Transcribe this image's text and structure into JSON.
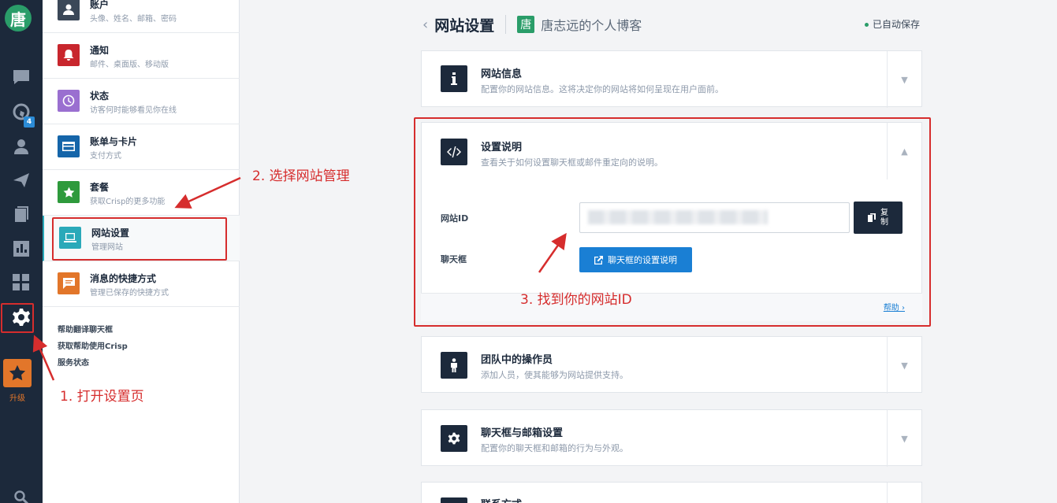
{
  "rail": {
    "logo_char": "唐",
    "badge": "4",
    "upgrade_label": "升级",
    "items": [
      "chat-icon",
      "globe-icon",
      "contacts-icon",
      "send-icon",
      "book-icon",
      "analytics-icon",
      "plugins-icon",
      "gear-icon",
      "star-icon",
      "search-icon"
    ]
  },
  "menu": {
    "items": [
      {
        "title": "账户",
        "sub": "头像、姓名、邮箱、密码",
        "color": "#3b4858",
        "icon": "user-icon"
      },
      {
        "title": "通知",
        "sub": "邮件、桌面版、移动版",
        "color": "#c8262d",
        "icon": "bell-icon"
      },
      {
        "title": "状态",
        "sub": "访客何时能够看见你在线",
        "color": "#9a6fd0",
        "icon": "clock-icon"
      },
      {
        "title": "账单与卡片",
        "sub": "支付方式",
        "color": "#1565a9",
        "icon": "card-icon"
      },
      {
        "title": "套餐",
        "sub": "获取Crisp的更多功能",
        "color": "#2e9a3c",
        "icon": "star-icon"
      },
      {
        "title": "网站设置",
        "sub": "管理网站",
        "color": "#2aa9b9",
        "icon": "laptop-icon"
      },
      {
        "title": "消息的快捷方式",
        "sub": "管理已保存的快捷方式",
        "color": "#e2762a",
        "icon": "message-icon"
      }
    ],
    "links": [
      "帮助翻译聊天框",
      "获取帮助使用Crisp",
      "服务状态"
    ]
  },
  "header": {
    "back": "‹",
    "title": "网站设置",
    "site_icon_char": "唐",
    "site_name": "唐志远的个人博客",
    "autosave": "已自动保存"
  },
  "cards": {
    "info": {
      "title": "网站信息",
      "sub": "配置你的网站信息。这将决定你的网站将如何呈现在用户面前。",
      "chevron": "▼"
    },
    "setup": {
      "title": "设置说明",
      "sub": "查看关于如何设置聊天框或邮件重定向的说明。",
      "chevron": "▲",
      "id_label": "网站ID",
      "chat_label": "聊天框",
      "copy_label": "复制",
      "chat_button": "聊天框的设置说明",
      "help": "帮助 ›"
    },
    "operators": {
      "title": "团队中的操作员",
      "sub": "添加人员，使其能够为网站提供支持。",
      "chevron": "▼"
    },
    "chatbox": {
      "title": "聊天框与邮箱设置",
      "sub": "配置你的聊天框和邮箱的行为与外观。",
      "chevron": "▼"
    },
    "contact": {
      "title": "联系方式"
    }
  },
  "annotations": {
    "step1": "1. 打开设置页",
    "step2": "2. 选择网站管理",
    "step3": "3. 找到你的网站ID"
  },
  "colors": {
    "accent": "#1a7fd4",
    "annotation": "#d62d2d",
    "rail": "#1c293b"
  }
}
